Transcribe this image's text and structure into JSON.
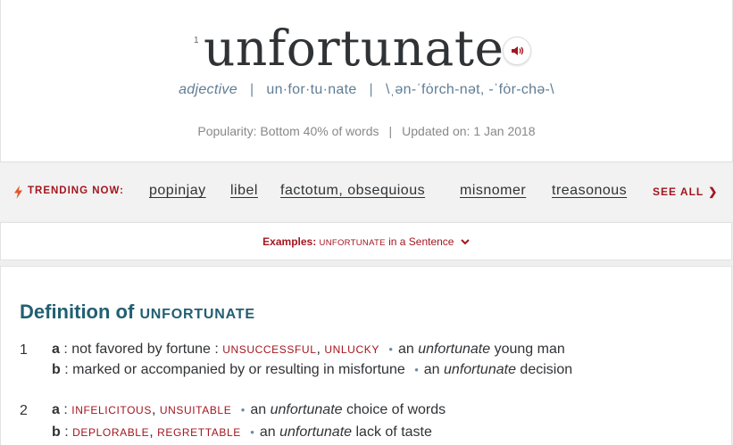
{
  "entry": {
    "homograph": "1",
    "headword": "unfortunate",
    "part_of_speech": "adjective",
    "syllables": "un·for·tu·nate",
    "pronunciation": "\\ˌən-ˈfȯrch-nət, -ˈfȯr-chə-\\",
    "separator": "|"
  },
  "popularity": {
    "text": "Popularity: Bottom 40% of words",
    "separator": "|",
    "updated": "Updated on: 1 Jan 2018"
  },
  "trending": {
    "label": "TRENDING NOW:",
    "links": [
      "popinjay",
      "libel",
      "factotum, obsequious",
      "misnomer",
      "treasonous"
    ],
    "see_all": "SEE ALL",
    "see_all_icon": "chevron-right-icon"
  },
  "examples": {
    "prefix": "Examples:",
    "word": "UNFORTUNATE",
    "suffix": "in a Sentence",
    "icon": "chevron-down-icon"
  },
  "definition": {
    "title": "Definition of",
    "word": "UNFORTUNATE",
    "senses": [
      {
        "num": "1",
        "subs": [
          {
            "letter": "a",
            "text": ": not favored by fortune :",
            "syn1": "UNSUCCESSFUL",
            "comma": ",",
            "syn2": "UNLUCKY",
            "bullet": "•",
            "ex_pre": "an",
            "ex_word": "unfortunate",
            "ex_post": "young man"
          },
          {
            "letter": "b",
            "text": ": marked or accompanied by or resulting in misfortune",
            "bullet": "•",
            "ex_pre": "an",
            "ex_word": "unfortunate",
            "ex_post": "decision"
          }
        ]
      },
      {
        "num": "2",
        "subs": [
          {
            "letter": "a",
            "text": ":",
            "syn1": "INFELICITOUS",
            "comma": ",",
            "syn2": "UNSUITABLE",
            "bullet": "•",
            "ex_pre": "an",
            "ex_word": "unfortunate",
            "ex_post": "choice of words"
          },
          {
            "letter": "b",
            "text": ":",
            "syn1": "DEPLORABLE",
            "comma": ",",
            "syn2": "REGRETTABLE",
            "bullet": "•",
            "ex_pre": "an",
            "ex_word": "unfortunate",
            "ex_post": "lack of taste"
          }
        ]
      }
    ]
  },
  "colors": {
    "accent_red": "#a3161f",
    "title_blue": "#225f73",
    "meta_blue": "#5f7d95",
    "text": "#303336"
  },
  "icons": {
    "audio": "speaker-icon",
    "trending": "lightning-bolt-icon"
  }
}
